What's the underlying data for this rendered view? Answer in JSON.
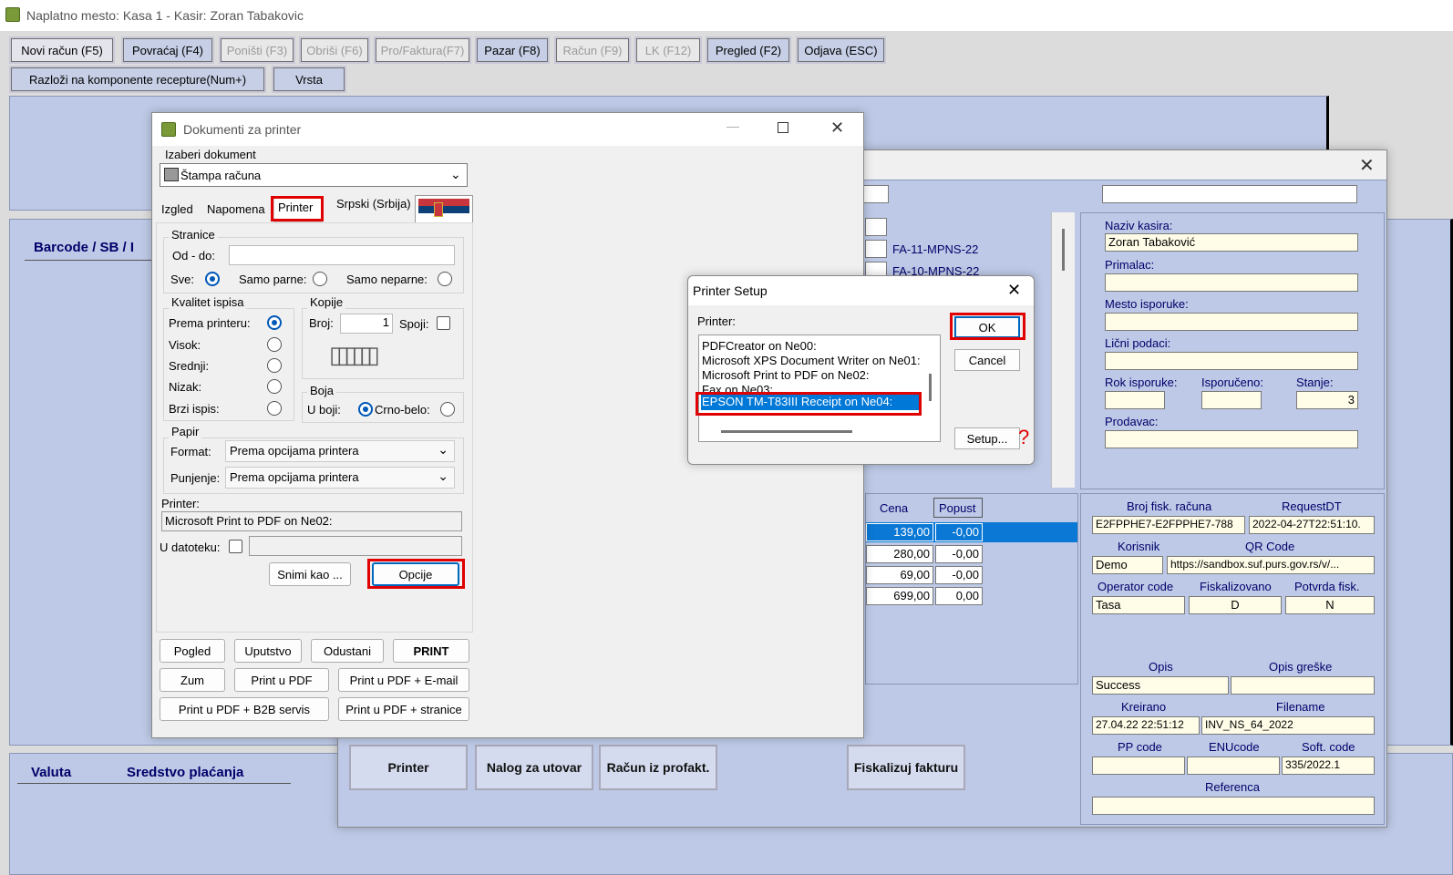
{
  "app": {
    "title": "Naplatno mesto: Kasa 1 - Kasir: Zoran Tabakovic"
  },
  "toolbar": {
    "row1": [
      "Novi račun (F5)",
      "Povraćaj (F4)",
      "Poništi (F3)",
      "Obriši (F6)",
      "Pro/Faktura(F7)",
      "Pazar (F8)",
      "Račun (F9)",
      "LK (F12)",
      "Pregled (F2)",
      "Odjava (ESC)"
    ],
    "row2": [
      "Razloži na komponente recepture(Num+)",
      "Vrsta"
    ]
  },
  "main": {
    "barcode_label": "Barcode / SB / I",
    "valuta_label": "Valuta",
    "sredstvo_label": "Sredstvo plaćanja"
  },
  "doc_list": [
    "FA-11-MPNS-22",
    "FA-10-MPNS-22"
  ],
  "items_table": {
    "headers": [
      "Cena",
      "Popust"
    ],
    "rows": [
      [
        "139,00",
        "-0,00"
      ],
      [
        "280,00",
        "-0,00"
      ],
      [
        "69,00",
        "-0,00"
      ],
      [
        "699,00",
        "0,00"
      ]
    ]
  },
  "right_panel": {
    "naziv_kasira_label": "Naziv kasira:",
    "naziv_kasira": "Zoran Tabaković",
    "primalac_label": "Primalac:",
    "mesto_isporuke_label": "Mesto isporuke:",
    "licni_podaci_label": "Lični podaci:",
    "rok_isporuke_label": "Rok isporuke:",
    "isporuceno_label": "Isporučeno:",
    "stanje_label": "Stanje:",
    "stanje": "3",
    "prodavac_label": "Prodavac:"
  },
  "fiscal": {
    "broj_label": "Broj fisk. računa",
    "request_label": "RequestDT",
    "broj": "E2FPPHE7-E2FPPHE7-788",
    "request": "2022-04-27T22:51:10.",
    "korisnik_label": "Korisnik",
    "qr_label": "QR Code",
    "korisnik": "Demo",
    "qr": "https://sandbox.suf.purs.gov.rs/v/...",
    "operator_label": "Operator code",
    "fiskalizovano_label": "Fiskalizovano",
    "potvrda_label": "Potvrda fisk.",
    "operator": "Tasa",
    "fiskalizovano": "D",
    "potvrda": "N",
    "opis_label": "Opis",
    "opis_greske_label": "Opis greške",
    "opis": "Success",
    "kreirano_label": "Kreirano",
    "filename_label": "Filename",
    "kreirano": "27.04.22 22:51:12",
    "filename": "INV_NS_64_2022",
    "pp_label": "PP code",
    "enu_label": "ENUcode",
    "soft_label": "Soft. code",
    "soft": "335/2022.1",
    "referenca_label": "Referenca"
  },
  "bottom_buttons": {
    "printer": "Printer",
    "nalog": "Nalog za utovar",
    "racun": "Račun iz profakt.",
    "fiskalizuj": "Fiskalizuj fakturu"
  },
  "dokumenti": {
    "title": "Dokumenti za printer",
    "izaberi_label": "Izaberi dokument",
    "selected_doc": "Štampa računa",
    "tabs": [
      "Izgled",
      "Napomena",
      "Printer"
    ],
    "lang": "Srpski (Srbija)",
    "stranice_title": "Stranice",
    "od_do_label": "Od - do:",
    "sve_label": "Sve:",
    "samo_parne_label": "Samo parne:",
    "samo_neparne_label": "Samo neparne:",
    "kvalitet_title": "Kvalitet ispisa",
    "kvalitet": [
      "Prema printeru:",
      "Visok:",
      "Srednji:",
      "Nizak:",
      "Brzi ispis:"
    ],
    "kopije_title": "Kopije",
    "broj_label": "Broj:",
    "broj_value": "1",
    "spoji_label": "Spoji:",
    "boja_title": "Boja",
    "u_boji_label": "U boji:",
    "crno_belo_label": "Crno-belo:",
    "papir_title": "Papir",
    "format_label": "Format:",
    "format_value": "Prema opcijama printera",
    "punjenje_label": "Punjenje:",
    "punjenje_value": "Prema opcijama printera",
    "printer_label": "Printer:",
    "printer_value": "Microsoft Print to PDF on Ne02:",
    "u_datoteku_label": "U datoteku:",
    "snimi_kao": "Snimi kao ...",
    "opcije": "Opcije",
    "buttons": [
      "Pogled",
      "Uputstvo",
      "Odustani",
      "PRINT",
      "Zum",
      "Print u PDF",
      "Print u PDF + E-mail",
      "Print u PDF + B2B servis",
      "Print u PDF + stranice"
    ]
  },
  "printer_setup": {
    "title": "Printer Setup",
    "printer_label": "Printer:",
    "printers": [
      "PDFCreator on Ne00:",
      "Microsoft XPS Document Writer on Ne01:",
      "Microsoft Print to PDF on Ne02:",
      "Fax on Ne03:",
      "EPSON TM-T83III Receipt on Ne04:"
    ],
    "ok": "OK",
    "cancel": "Cancel",
    "setup": "Setup...",
    "help_mark": "?"
  }
}
